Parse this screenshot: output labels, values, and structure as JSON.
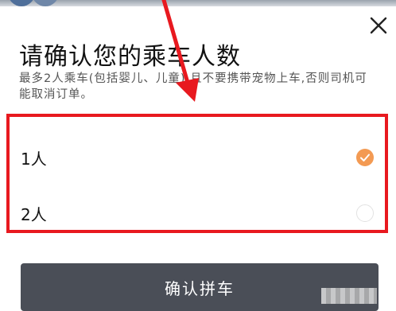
{
  "dialog": {
    "title": "请确认您的乘车人数",
    "description": "最多2人乘车(包括婴儿、儿童),且不要携带宠物上车,否则司机可能取消订单。",
    "close_icon": "close-icon"
  },
  "options": [
    {
      "label": "1人",
      "selected": true
    },
    {
      "label": "2人",
      "selected": false
    }
  ],
  "confirm_button": {
    "label": "确认拼车"
  },
  "annotation": {
    "highlight_color": "#e8191f",
    "arrow_color": "#e8191f"
  },
  "colors": {
    "accent": "#f39a53",
    "button_bg": "#4a4e57"
  }
}
